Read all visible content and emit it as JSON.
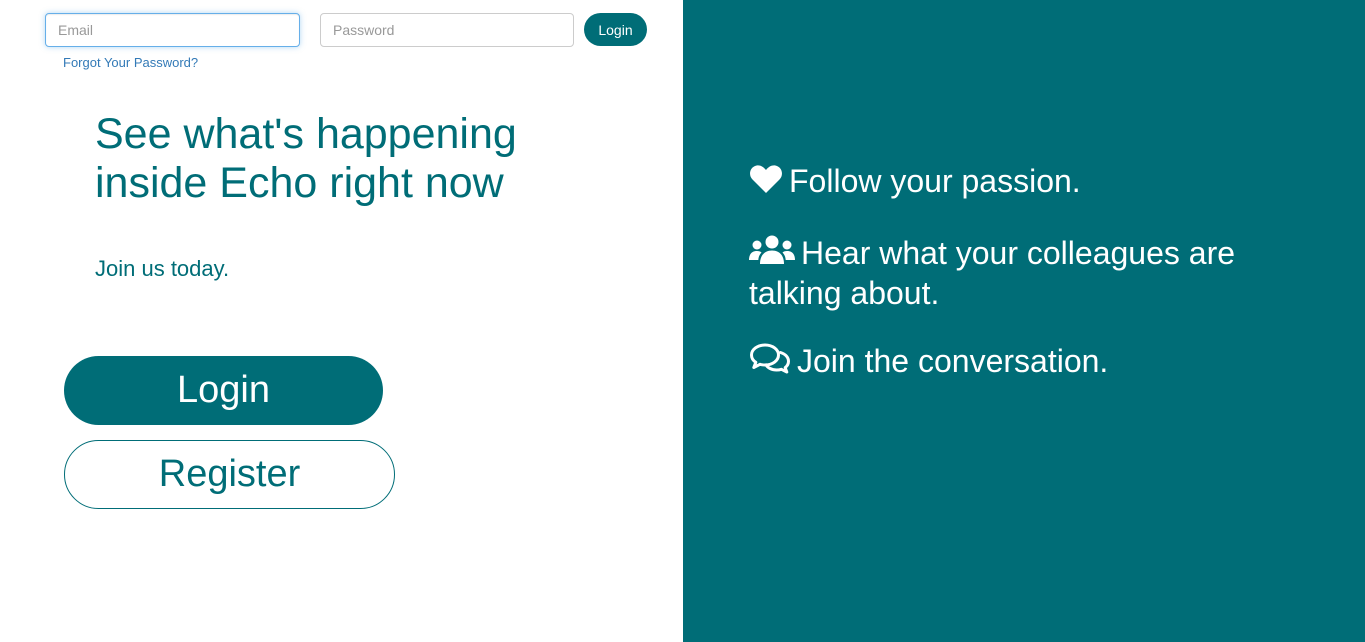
{
  "login_form": {
    "email_placeholder": "Email",
    "email_value": "",
    "password_placeholder": "Password",
    "password_value": "",
    "login_label": "Login",
    "forgot_label": "Forgot Your Password?"
  },
  "hero": {
    "headline": "See what's happening inside Echo right now",
    "subline": "Join us today.",
    "login_label": "Login",
    "register_label": "Register"
  },
  "features": [
    {
      "icon": "heart-icon",
      "text": "Follow your passion."
    },
    {
      "icon": "users-icon",
      "text": "Hear what your colleagues are talking about."
    },
    {
      "icon": "comments-icon",
      "text": "Join the conversation."
    }
  ],
  "colors": {
    "brand": "#006d77",
    "link": "#337ab7",
    "background": "#ffffff"
  }
}
